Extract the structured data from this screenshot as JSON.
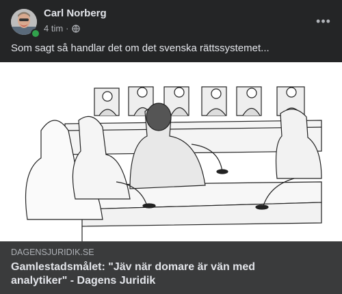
{
  "post": {
    "author": "Carl Norberg",
    "time": "4 tim",
    "separator": "·",
    "privacy_icon": "globe-icon",
    "more_icon": "more-horizontal-icon",
    "more_glyph": "•••",
    "text": "Som sagt så handlar det om det svenska rättssystemet..."
  },
  "link_preview": {
    "domain": "DAGENSJURIDIK.SE",
    "title": "Gamlestadsmålet: \"Jäv när domare är vän med analytiker\" - Dagens Juridik",
    "image_desc_icon": "courtroom-sketch-image"
  },
  "colors": {
    "background": "#242526",
    "footer": "#3a3b3c",
    "text_primary": "#e4e6eb",
    "text_secondary": "#b0b3b8",
    "online": "#31a24c"
  }
}
